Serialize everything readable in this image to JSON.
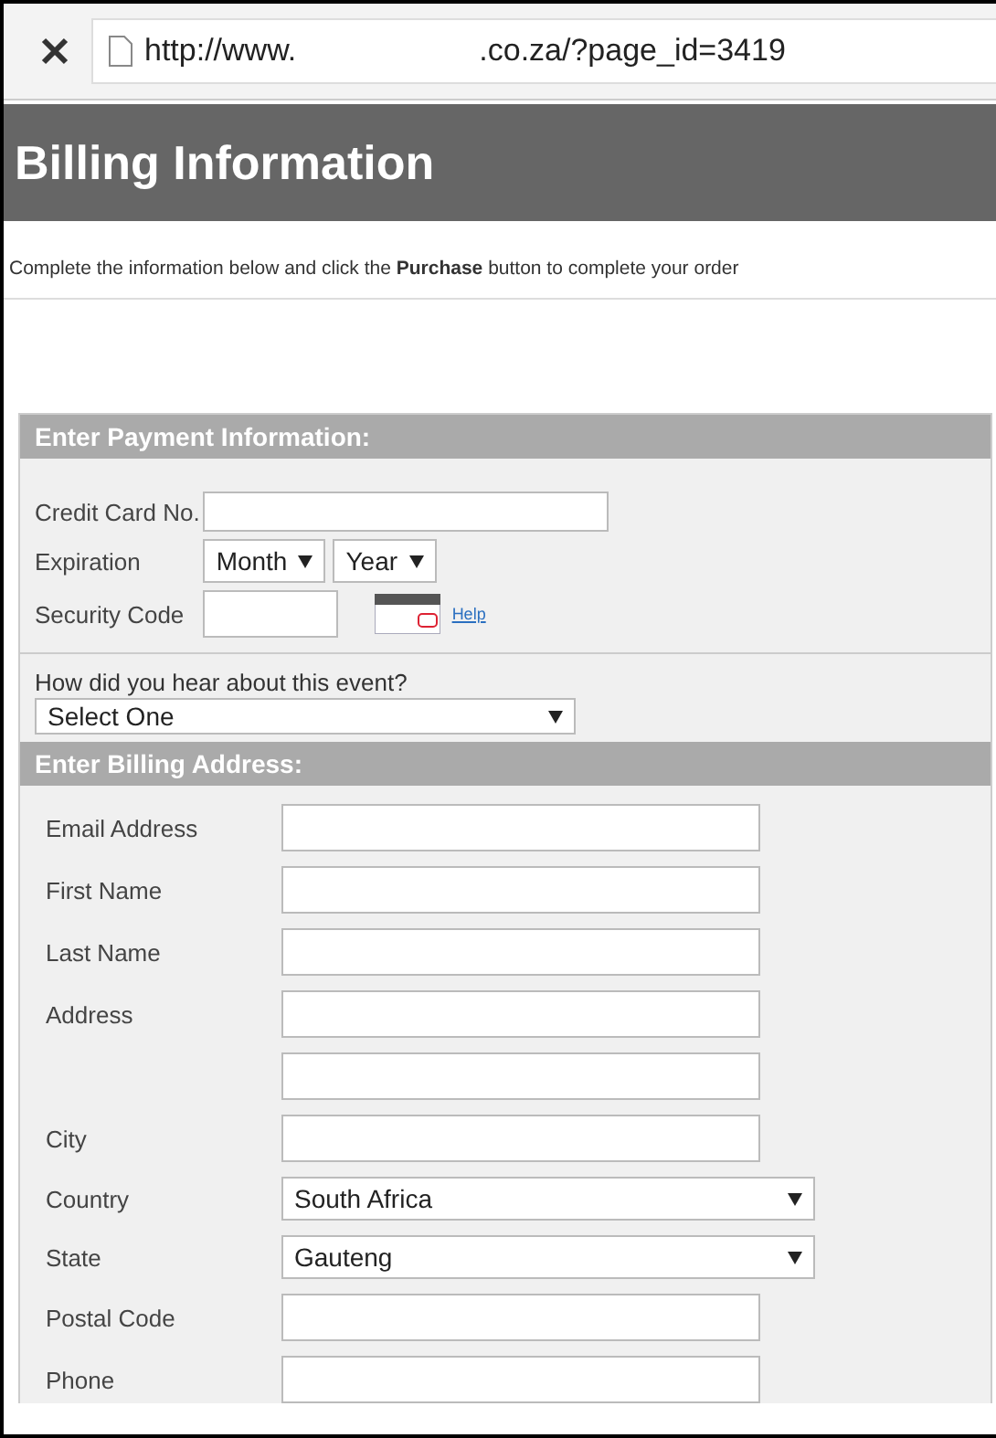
{
  "browser": {
    "url_start": "http://www.",
    "url_end": ".co.za/?page_id=3419"
  },
  "page": {
    "title": "Billing Information",
    "instructions": "Complete the information below and click the **Purchase** button to complete your order"
  },
  "payment": {
    "heading": "Enter Payment Information:",
    "rows": [
      {
        "kind": "input",
        "label": "Credit Card No."
      },
      {
        "kind": "expiration",
        "label": "Expiration",
        "month": "Month",
        "year": "Year"
      },
      {
        "kind": "security",
        "label": "Security Code",
        "help": "Help"
      }
    ],
    "question": "How did you hear about this event?",
    "answer": "Select One"
  },
  "billing": {
    "heading": "Enter Billing Address:",
    "rows": [
      {
        "kind": "input",
        "label": "Email Address"
      },
      {
        "kind": "input",
        "label": "First Name"
      },
      {
        "kind": "input",
        "label": "Last Name"
      },
      {
        "kind": "input",
        "label": "Address"
      },
      {
        "kind": "input"
      },
      {
        "kind": "input",
        "label": "City"
      },
      {
        "kind": "select",
        "label": "Country",
        "value": "South Africa"
      },
      {
        "kind": "select",
        "label": "State",
        "value": "Gauteng"
      },
      {
        "kind": "input",
        "label": "Postal Code"
      },
      {
        "kind": "input",
        "label": "Phone"
      }
    ]
  }
}
